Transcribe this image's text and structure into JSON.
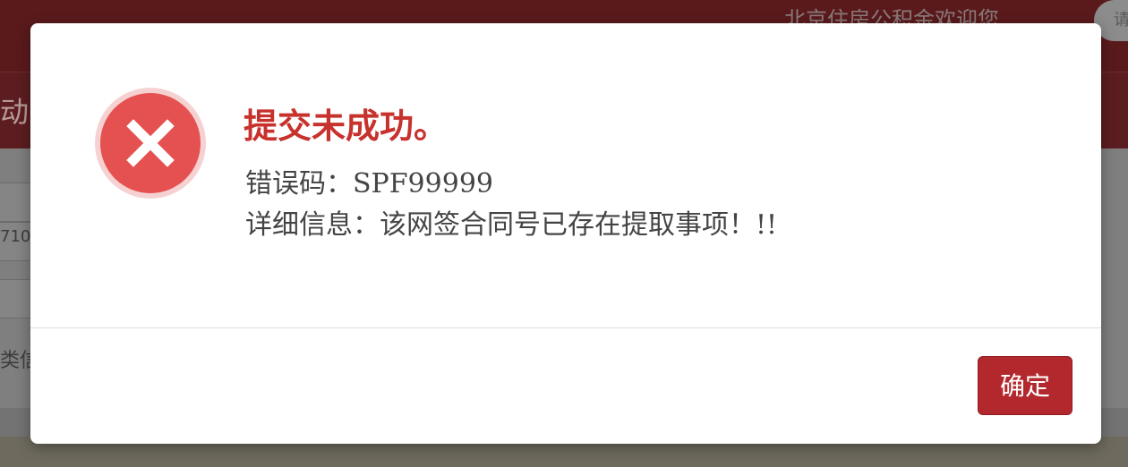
{
  "background": {
    "welcome_text": "北京住房公积金欢迎您",
    "search_text": "请",
    "redbar_text": "动中",
    "field_value": "710",
    "label_text": "类信"
  },
  "dialog": {
    "icon": "error-x-icon",
    "title": "提交未成功。",
    "error_code_line": "错误码：SPF99999",
    "detail_line": "详细信息：该网签合同号已存在提取事项！!!",
    "confirm_label": "确定"
  },
  "colors": {
    "title": "#c7322d",
    "icon": "#e55050",
    "button": "#b3282d",
    "header_bg": "#5a1a1c"
  }
}
